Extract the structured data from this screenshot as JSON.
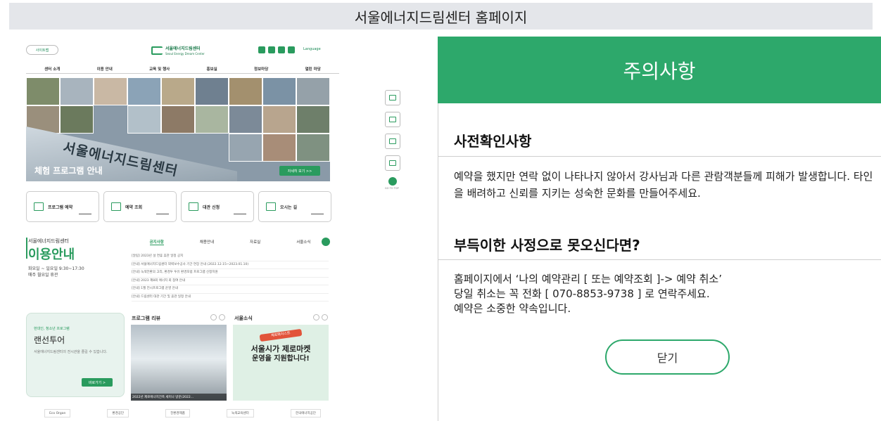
{
  "caption": "서울에너지드림센터 홈페이지",
  "site": {
    "sitemap": "사이트맵",
    "logo_kr": "서울에너지드림센터",
    "logo_en": "Seoul Energy Dream Center",
    "language": "Language",
    "nav": [
      "센터 소개",
      "이용 안내",
      "교육 및 행사",
      "홍보실",
      "정보마당",
      "열린 마당"
    ],
    "hero_building_text": "서울에너지드림센터",
    "hero_title": "체험 프로그램 안내",
    "hero_more": "자세히 보기 >>",
    "quick": [
      "프로그램 예약",
      "예약 조회",
      "대관 신청",
      "오시는 길"
    ],
    "side_menu": [
      "프로그램 예약",
      "예약조회",
      "대관안내",
      "오시는 길"
    ],
    "side_top": "GO TO TOP",
    "info_center": "서울에너지드림센터",
    "info_title": "이용안내",
    "info_hours": "화요일 ~ 일요일 9:30~17:30",
    "info_closed": "매주 월요일 휴관",
    "tabs": [
      "공지사항",
      "채용안내",
      "자료실",
      "서울소식"
    ],
    "notices": [
      "[알림] 2023년 설 연휴 휴관 일정 공지",
      "[안내] 서울에너지드림센터 외벽보수공사 기간 연장 안내 (2022.12.15~2023.01.10)",
      "[안내] 녹색전환의 고리, 환경투 투유 환경포럼 프로그램 신청지원",
      "[안내] 2023 제8회 에너지 회 참여 안내",
      "[안내] 1월 전시프로그램 운영 안내",
      "[안내] 드림센터 대관 기간 및 휴관 일정 안내"
    ],
    "card_sub": "현대인, 청소년 프로그램",
    "card_title": "랜선투어",
    "card_desc": "서울에너지드림센터의 전시관을 즐길 수 있습니다.",
    "card_btn": "바로가기 >",
    "review_title": "프로그램 리뷰",
    "review_caption": "2022년 제로에너지건축 세미나 방문(2022...",
    "news_title": "서울소식",
    "news_tag": "제로웨이스트",
    "news_head1": "서울시가 제로마켓",
    "news_head2": "운영을 지원합니다!",
    "partners": [
      "Eco Organ",
      "환경공단",
      "친환경제품",
      "녹색교육센터",
      "한국에너지공단"
    ]
  },
  "notice_panel": {
    "title": "주의사항",
    "sec1_title": "사전확인사항",
    "sec1_text": "예약을 했지만 연락 없이 나타나지 않아서 강사님과 다른 관람객분들께 피해가 발생합니다. 타인을 배려하고 신뢰를 지키는 성숙한 문화를 만들어주세요.",
    "sec2_title": "부득이한 사정으로 못오신다면?",
    "sec2_line1": "홈페이지에서 ‘나의 예약관리 [ 또는 예약조회 ]-> 예약 취소’",
    "sec2_line2": "당일 취소는 꼭 전화 [ 070-8853-9738 ] 로 연락주세요.",
    "sec2_line3": "예약은 소중한 약속입니다.",
    "close_label": "닫기"
  },
  "colors": {
    "accent": "#2da86b",
    "caption_bg": "#e4e6ea"
  }
}
